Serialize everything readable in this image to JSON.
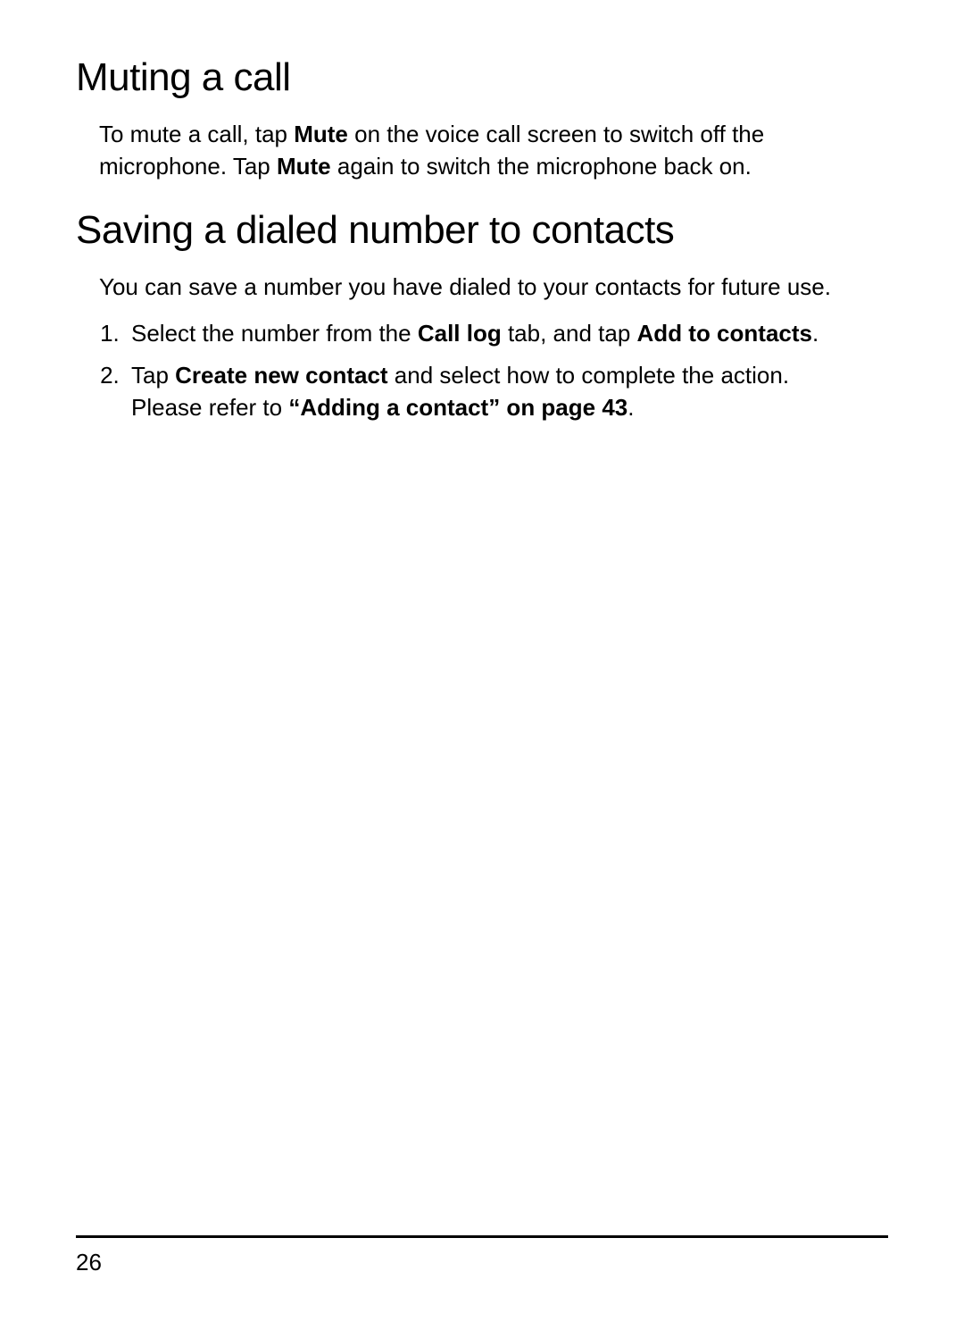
{
  "section1": {
    "heading": "Muting a call",
    "para_parts": {
      "t1": "To mute a call, tap ",
      "b1": "Mute",
      "t2": " on the voice call screen to switch off the microphone. Tap ",
      "b2": "Mute",
      "t3": " again to switch the microphone back on."
    }
  },
  "section2": {
    "heading": "Saving a dialed number to contacts",
    "para": "You can save a number you have dialed to your contacts for future use.",
    "list": {
      "item1": {
        "t1": "Select the number from the ",
        "b1": "Call log",
        "t2": " tab, and tap ",
        "b2": "Add to contacts",
        "t3": "."
      },
      "item2": {
        "t1": "Tap ",
        "b1": "Create new contact",
        "t2": " and select how to complete the action. Please refer to ",
        "b2": "“Adding a contact” on page 43",
        "t3": "."
      }
    }
  },
  "page_number": "26"
}
